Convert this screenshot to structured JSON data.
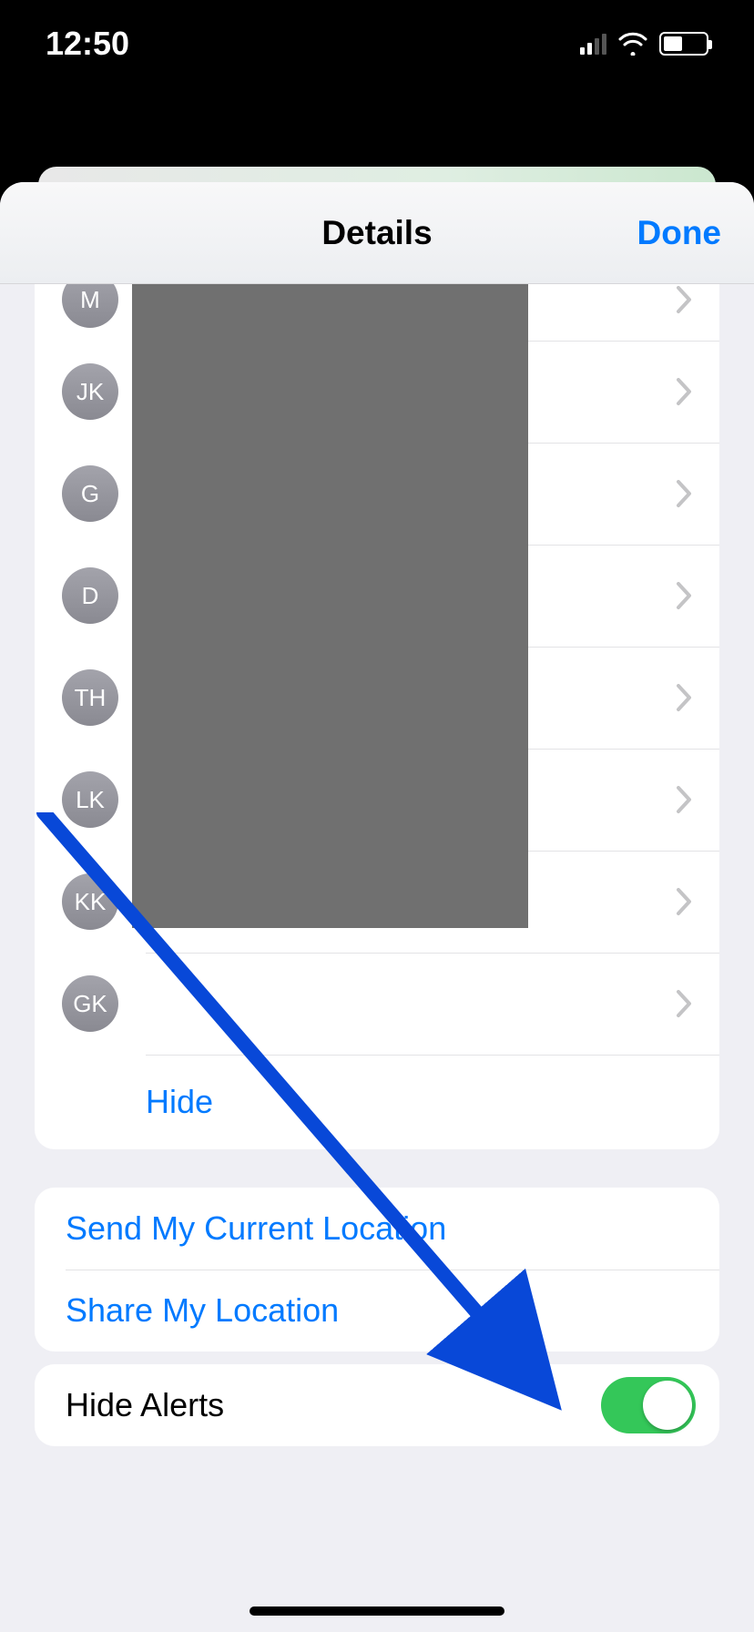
{
  "status": {
    "time": "12:50"
  },
  "sheet": {
    "title": "Details",
    "done": "Done"
  },
  "contacts": [
    {
      "initials": "M"
    },
    {
      "initials": "JK"
    },
    {
      "initials": "G"
    },
    {
      "initials": "D"
    },
    {
      "initials": "TH"
    },
    {
      "initials": "LK"
    },
    {
      "initials": "KK"
    },
    {
      "initials": "GK"
    }
  ],
  "hide_label": "Hide",
  "actions": {
    "send_location": "Send My Current Location",
    "share_location": "Share My Location"
  },
  "hide_alerts": {
    "label": "Hide Alerts",
    "on": true
  }
}
